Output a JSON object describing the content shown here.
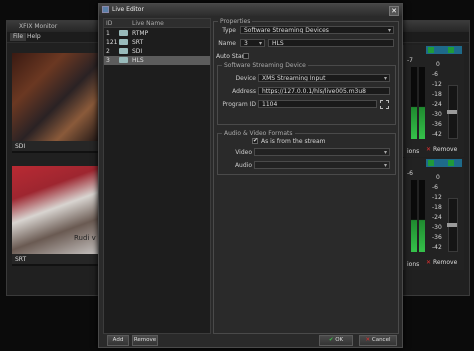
{
  "background_app": {
    "title": "XFIX Monitor",
    "menu": [
      "File",
      "Help"
    ],
    "sources": [
      {
        "caption": "SDI"
      },
      {
        "caption": "SRT",
        "overlay_text": "Rudi v"
      }
    ],
    "meter_panels": [
      {
        "label_left": "ions",
        "remove_label": "Remove",
        "scale": [
          "-7",
          "0",
          "-6",
          "-12",
          "-18",
          "-24",
          "-30",
          "-36",
          "-42"
        ]
      },
      {
        "label_left": "ions",
        "remove_label": "Remove",
        "scale": [
          "-6",
          "0",
          "-6",
          "-12",
          "-18",
          "-24",
          "-30",
          "-36",
          "-42"
        ]
      }
    ]
  },
  "dialog": {
    "title": "Live Editor",
    "list": {
      "headers": {
        "id": "ID",
        "name": "Live Name"
      },
      "rows": [
        {
          "id": "1",
          "name": "RTMP",
          "selected": false
        },
        {
          "id": "121",
          "name": "SRT",
          "selected": false
        },
        {
          "id": "2",
          "name": "SDI",
          "selected": false
        },
        {
          "id": "3",
          "name": "HLS",
          "selected": true
        }
      ]
    },
    "buttons": {
      "add": "Add",
      "remove": "Remove",
      "ok": "OK",
      "cancel": "Cancel"
    },
    "properties": {
      "group_title": "Properties",
      "type_label": "Type",
      "type_value": "Software Streaming Devices",
      "name_label": "Name",
      "name_number": "3",
      "name_value": "HLS",
      "auto_start_label": "Auto Start",
      "software_group_title": "Software Streaming Device",
      "device_label": "Device",
      "device_value": "XMS Streaming Input",
      "address_label": "Address",
      "address_value": "https://127.0.0.1/hls/live005.m3u8",
      "program_id_label": "Program ID",
      "program_id_value": "1104",
      "av_group_title": "Audio & Video Formats",
      "as_from_stream_label": "As is from the stream",
      "as_from_stream_checked": true,
      "video_label": "Video",
      "audio_label": "Audio"
    }
  },
  "colors": {
    "accent_green": "#1f9a3a",
    "remove_red": "#e03030",
    "selection": "#5c5c5c"
  }
}
